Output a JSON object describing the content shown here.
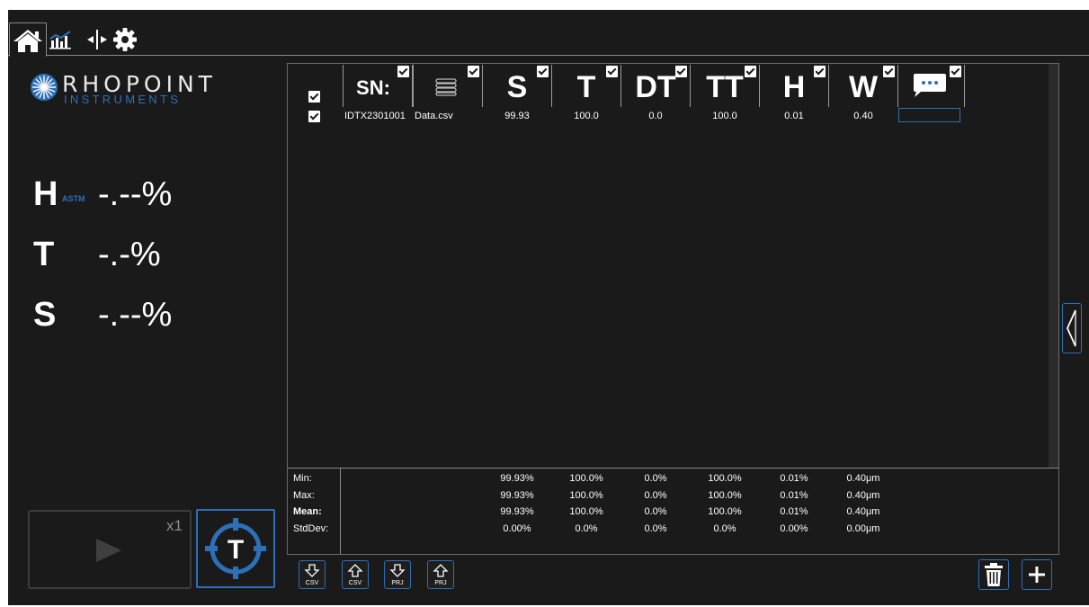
{
  "tabs": [
    {
      "name": "home",
      "icon": "home-icon"
    },
    {
      "name": "statistics",
      "icon": "bar-chart-icon"
    },
    {
      "name": "mode",
      "icon": "split-arrows-icon"
    },
    {
      "name": "settings",
      "icon": "gear-icon"
    }
  ],
  "logo": {
    "word": "RHOPOINT",
    "sub": "INSTRUMENTS"
  },
  "readouts": {
    "haze": {
      "label": "H",
      "subscript": "ASTM",
      "value": "-.--%"
    },
    "transmission": {
      "label": "T",
      "value": "-.-%"
    },
    "sheen": {
      "label": "S",
      "value": "-.--%"
    }
  },
  "play": {
    "count": "x1"
  },
  "target": {
    "letter": "T"
  },
  "table": {
    "columns": [
      {
        "key": "sn",
        "label": "SN:"
      },
      {
        "key": "file",
        "label": "",
        "icon": "stack-icon"
      },
      {
        "key": "s",
        "label": "S"
      },
      {
        "key": "t",
        "label": "T"
      },
      {
        "key": "dt",
        "label": "DT"
      },
      {
        "key": "tt",
        "label": "TT"
      },
      {
        "key": "h",
        "label": "H"
      },
      {
        "key": "w",
        "label": "W"
      },
      {
        "key": "comment",
        "label": "",
        "icon": "comment-icon"
      }
    ],
    "rows": [
      {
        "sn": "IDTX2301001",
        "file": "Data.csv",
        "s": "99.93",
        "t": "100.0",
        "dt": "0.0",
        "tt": "100.0",
        "h": "0.01",
        "w": "0.40"
      }
    ]
  },
  "stats": {
    "labels": [
      "Min:",
      "Max:",
      "Mean:",
      "StdDev:"
    ],
    "s": [
      "99.93%",
      "99.93%",
      "99.93%",
      "0.00%"
    ],
    "t": [
      "100.0%",
      "100.0%",
      "100.0%",
      "0.0%"
    ],
    "dt": [
      "0.0%",
      "0.0%",
      "0.0%",
      "0.0%"
    ],
    "tt": [
      "100.0%",
      "100.0%",
      "100.0%",
      "0.0%"
    ],
    "h": [
      "0.01%",
      "0.01%",
      "0.01%",
      "0.00%"
    ],
    "w": [
      "0.40μm",
      "0.40μm",
      "0.40μm",
      "0.00μm"
    ]
  },
  "bottom_buttons": [
    {
      "name": "download-csv",
      "caption": "CSV",
      "arrow": "down"
    },
    {
      "name": "upload-csv",
      "caption": "CSV",
      "arrow": "up"
    },
    {
      "name": "download-prj",
      "caption": "PRJ",
      "arrow": "down"
    },
    {
      "name": "upload-prj",
      "caption": "PRJ",
      "arrow": "up"
    }
  ],
  "colors": {
    "background": "#1a1a1a",
    "accent": "#2d6fb8",
    "border": "#8a8a8a"
  }
}
